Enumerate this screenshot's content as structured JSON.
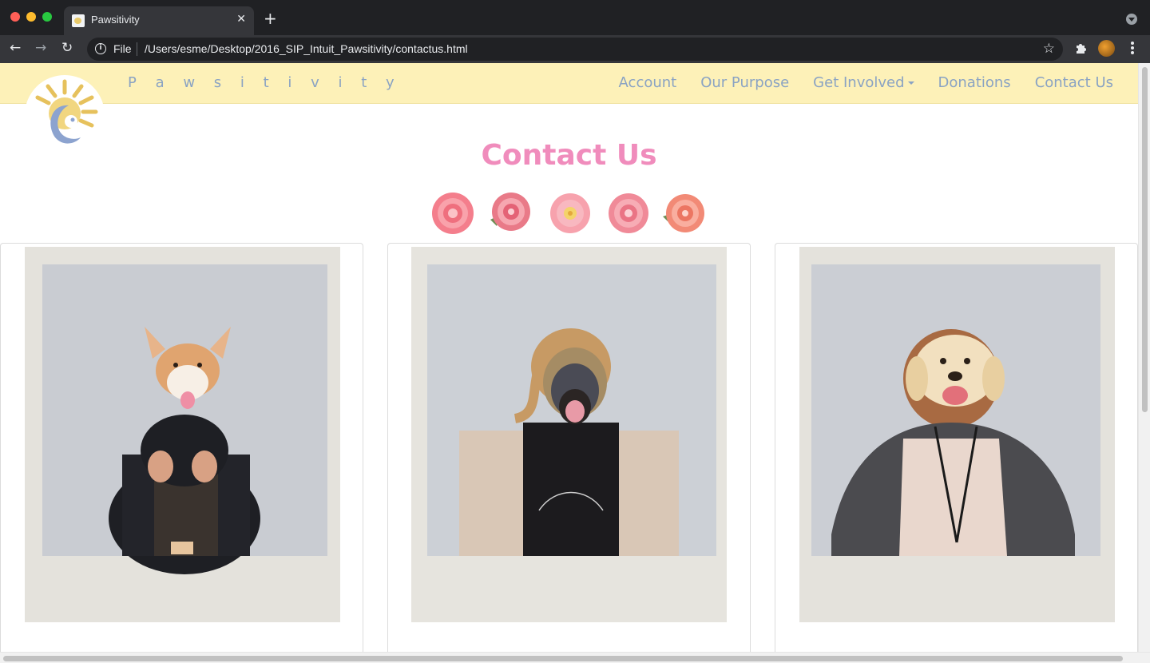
{
  "browser": {
    "tab_title": "Pawsitivity",
    "tab_close": "✕",
    "new_tab": "+",
    "nav_back": "←",
    "nav_forward": "→",
    "nav_reload": "↻",
    "info_glyph": "i",
    "scheme_label": "File",
    "url": "/Users/esme/Desktop/2016_SIP_Intuit_Pawsitivity/contactus.html",
    "bookmark_star": "☆"
  },
  "site": {
    "brand": "P a w s i t i v i t y",
    "nav": {
      "account": "Account",
      "our_purpose": "Our Purpose",
      "get_involved": "Get Involved",
      "donations": "Donations",
      "contact_us": "Contact Us"
    },
    "page_title": "Contact Us"
  },
  "icons": {
    "logo": "sun-and-face-logo-icon",
    "roses": [
      "rose-icon",
      "rose-icon",
      "hibiscus-icon",
      "rose-icon",
      "rose-icon"
    ]
  },
  "colors": {
    "navbar_bg": "#fdf1b8",
    "nav_text": "#8aa3c3",
    "title_pink": "#f08cbc"
  },
  "team": [
    {
      "dog_mask": "corgi"
    },
    {
      "dog_mask": "great-dane"
    },
    {
      "dog_mask": "golden-retriever-puppy"
    }
  ]
}
